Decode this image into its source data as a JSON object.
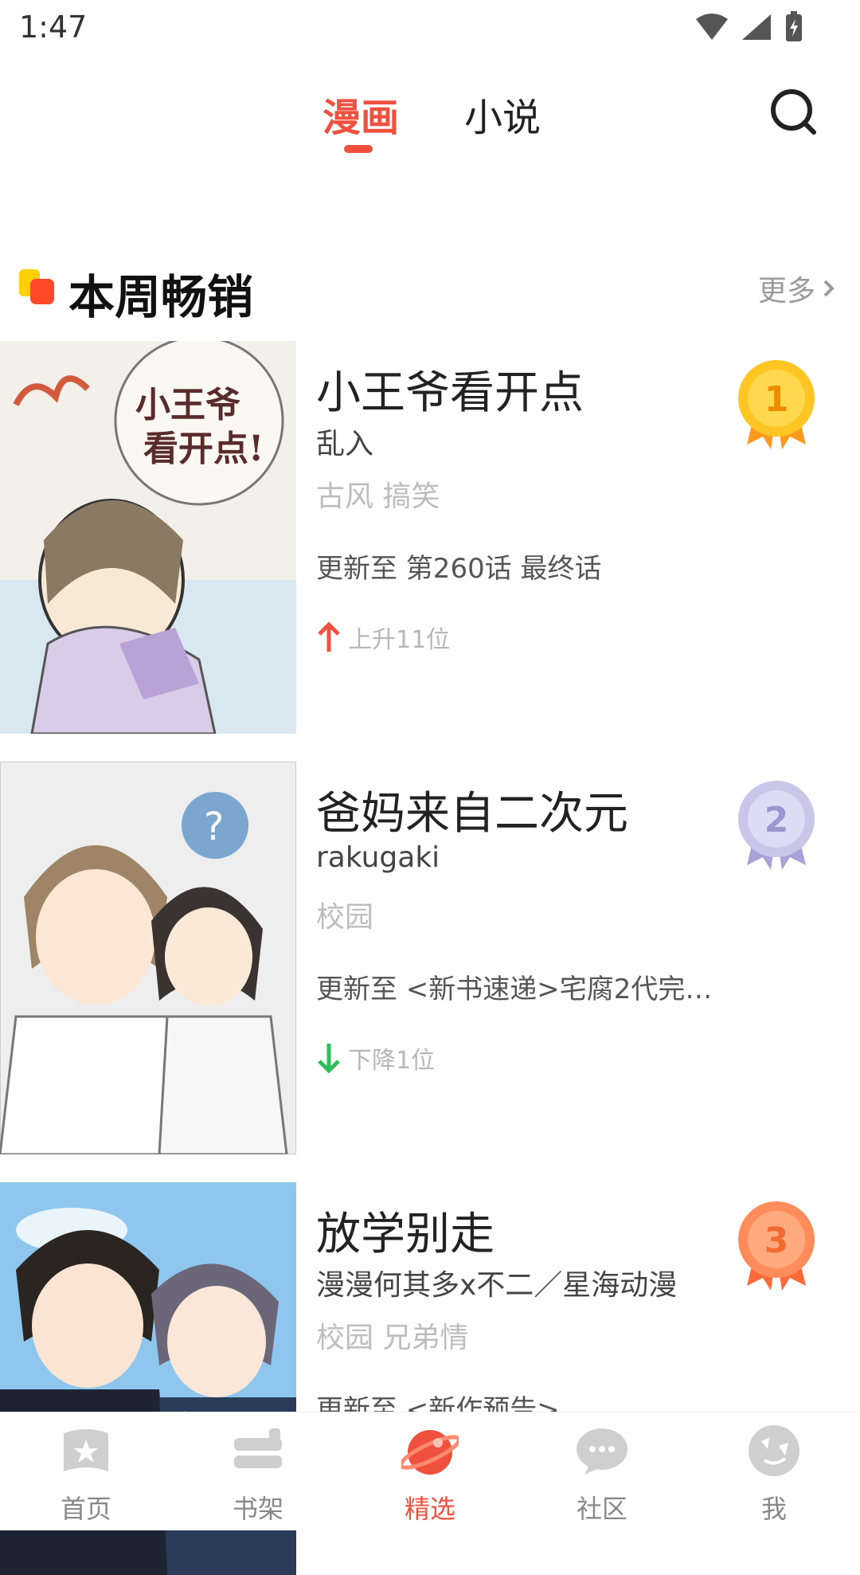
{
  "status_bar": {
    "time": "1:47"
  },
  "top_tabs": {
    "active": "漫画",
    "inactive": "小说"
  },
  "section": {
    "title": "本周畅销",
    "more": "更多"
  },
  "ranking": [
    {
      "rank": "1",
      "title": "小王爷看开点",
      "author": "乱入",
      "tags": "古风 搞笑",
      "update": "更新至 第260话 最终话",
      "trend": "上升11位",
      "trend_dir": "up"
    },
    {
      "rank": "2",
      "title": "爸妈来自二次元",
      "author": "rakugaki",
      "tags": "校园",
      "update": "更新至 <新书速递>宅腐2代完…",
      "trend": "下降1位",
      "trend_dir": "down"
    },
    {
      "rank": "3",
      "title": "放学别走",
      "author": "漫漫何其多x不二／星海动漫",
      "tags": "校园 兄弟情",
      "update": "更新至 <新作预告>",
      "trend": "",
      "trend_dir": ""
    }
  ],
  "bottom_nav": [
    {
      "label": "首页",
      "icon": "home-star-icon"
    },
    {
      "label": "书架",
      "icon": "bookshelf-icon"
    },
    {
      "label": "精选",
      "icon": "planet-icon",
      "active": true
    },
    {
      "label": "社区",
      "icon": "chat-bubble-icon"
    },
    {
      "label": "我",
      "icon": "profile-mascot-icon"
    }
  ],
  "colors": {
    "accent": "#f0513f",
    "gold": "#ffb400",
    "silver": "#b8b5df",
    "bronze": "#ff7a4a",
    "up": "#f0513f",
    "down": "#2ebf5a"
  }
}
